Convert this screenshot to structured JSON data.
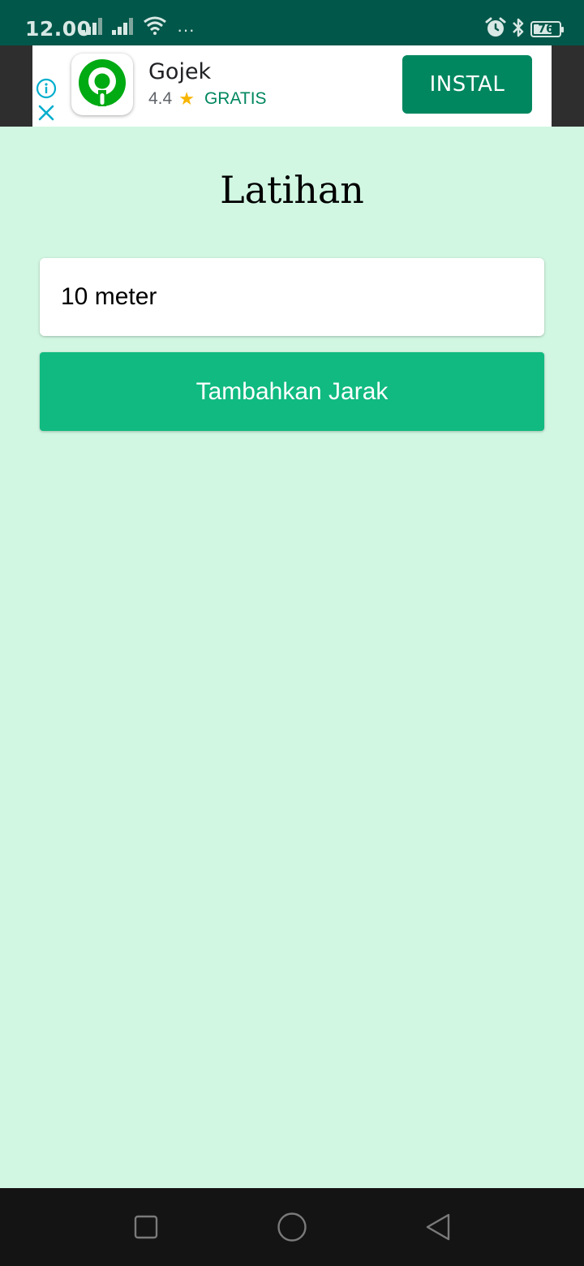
{
  "status_bar": {
    "time": "12.00",
    "more_indicator": "···",
    "battery_percent": 76,
    "battery_label": "76",
    "icons": [
      "signal-icon",
      "signal-icon",
      "wifi-icon",
      "more-icon",
      "alarm-icon",
      "bluetooth-icon",
      "battery-icon"
    ]
  },
  "ad": {
    "app_name": "Gojek",
    "rating": "4.4",
    "rating_star": "★",
    "price": "GRATIS",
    "install_label": "INSTAL",
    "brand_color": "#01875f",
    "logo_color": "#00aa13",
    "icons": [
      "ad-info-icon",
      "ad-close-icon",
      "gojek-logo-icon",
      "star-icon"
    ]
  },
  "main": {
    "title": "Latihan",
    "input": {
      "value": "10 meter"
    },
    "button_label": "Tambahkan Jarak",
    "background_color": "#d1f7e2",
    "button_color": "#10ba80"
  },
  "nav_bar": {
    "icons": [
      "recents-icon",
      "home-icon",
      "back-icon"
    ]
  }
}
